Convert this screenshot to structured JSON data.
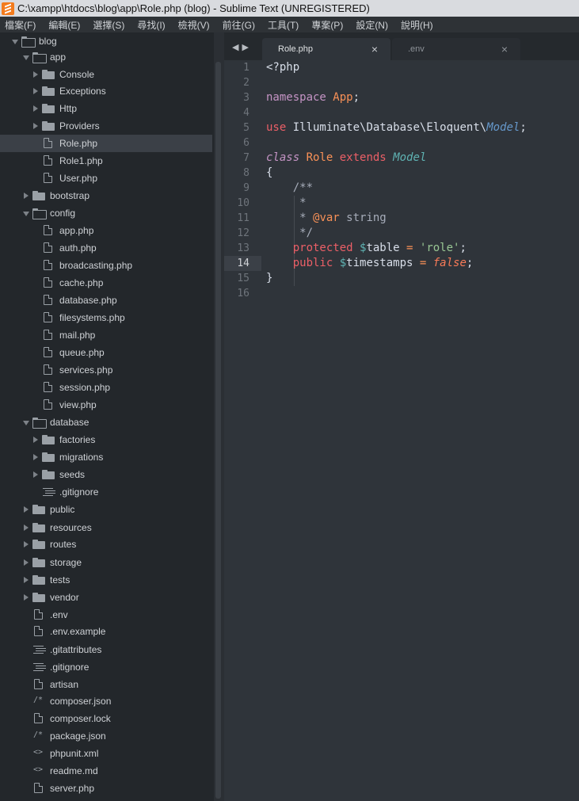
{
  "window": {
    "title": "C:\\xampp\\htdocs\\blog\\app\\Role.php (blog) - Sublime Text (UNREGISTERED)"
  },
  "menu": [
    "檔案(F)",
    "編輯(E)",
    "選擇(S)",
    "尋找(I)",
    "檢視(V)",
    "前往(G)",
    "工具(T)",
    "專案(P)",
    "設定(N)",
    "說明(H)"
  ],
  "sidebar": {
    "items": [
      {
        "label": "blog",
        "type": "folder",
        "open": true,
        "depth": 0
      },
      {
        "label": "app",
        "type": "folder",
        "open": true,
        "depth": 1
      },
      {
        "label": "Console",
        "type": "folder",
        "open": false,
        "depth": 2
      },
      {
        "label": "Exceptions",
        "type": "folder",
        "open": false,
        "depth": 2
      },
      {
        "label": "Http",
        "type": "folder",
        "open": false,
        "depth": 2
      },
      {
        "label": "Providers",
        "type": "folder",
        "open": false,
        "depth": 2
      },
      {
        "label": "Role.php",
        "type": "file",
        "depth": 2,
        "selected": true
      },
      {
        "label": "Role1.php",
        "type": "file",
        "depth": 2
      },
      {
        "label": "User.php",
        "type": "file",
        "depth": 2
      },
      {
        "label": "bootstrap",
        "type": "folder",
        "open": false,
        "depth": 1
      },
      {
        "label": "config",
        "type": "folder",
        "open": true,
        "depth": 1
      },
      {
        "label": "app.php",
        "type": "file",
        "depth": 2
      },
      {
        "label": "auth.php",
        "type": "file",
        "depth": 2
      },
      {
        "label": "broadcasting.php",
        "type": "file",
        "depth": 2
      },
      {
        "label": "cache.php",
        "type": "file",
        "depth": 2
      },
      {
        "label": "database.php",
        "type": "file",
        "depth": 2
      },
      {
        "label": "filesystems.php",
        "type": "file",
        "depth": 2
      },
      {
        "label": "mail.php",
        "type": "file",
        "depth": 2
      },
      {
        "label": "queue.php",
        "type": "file",
        "depth": 2
      },
      {
        "label": "services.php",
        "type": "file",
        "depth": 2
      },
      {
        "label": "session.php",
        "type": "file",
        "depth": 2
      },
      {
        "label": "view.php",
        "type": "file",
        "depth": 2
      },
      {
        "label": "database",
        "type": "folder",
        "open": true,
        "depth": 1
      },
      {
        "label": "factories",
        "type": "folder",
        "open": false,
        "depth": 2
      },
      {
        "label": "migrations",
        "type": "folder",
        "open": false,
        "depth": 2
      },
      {
        "label": "seeds",
        "type": "folder",
        "open": false,
        "depth": 2
      },
      {
        "label": ".gitignore",
        "type": "text",
        "depth": 2
      },
      {
        "label": "public",
        "type": "folder",
        "open": false,
        "depth": 1
      },
      {
        "label": "resources",
        "type": "folder",
        "open": false,
        "depth": 1
      },
      {
        "label": "routes",
        "type": "folder",
        "open": false,
        "depth": 1
      },
      {
        "label": "storage",
        "type": "folder",
        "open": false,
        "depth": 1
      },
      {
        "label": "tests",
        "type": "folder",
        "open": false,
        "depth": 1
      },
      {
        "label": "vendor",
        "type": "folder",
        "open": false,
        "depth": 1
      },
      {
        "label": ".env",
        "type": "file",
        "depth": 1
      },
      {
        "label": ".env.example",
        "type": "file",
        "depth": 1
      },
      {
        "label": ".gitattributes",
        "type": "text",
        "depth": 1
      },
      {
        "label": ".gitignore",
        "type": "text",
        "depth": 1
      },
      {
        "label": "artisan",
        "type": "file",
        "depth": 1
      },
      {
        "label": "composer.json",
        "type": "json",
        "depth": 1
      },
      {
        "label": "composer.lock",
        "type": "file",
        "depth": 1
      },
      {
        "label": "package.json",
        "type": "json",
        "depth": 1
      },
      {
        "label": "phpunit.xml",
        "type": "xml",
        "depth": 1
      },
      {
        "label": "readme.md",
        "type": "xml",
        "depth": 1
      },
      {
        "label": "server.php",
        "type": "file",
        "depth": 1
      }
    ]
  },
  "tabs": [
    {
      "label": "Role.php",
      "active": true
    },
    {
      "label": ".env",
      "active": false
    }
  ],
  "editor": {
    "current_line": 14,
    "lines": [
      [
        [
          "<?php",
          "punct"
        ]
      ],
      [],
      [
        [
          "namespace ",
          "kw"
        ],
        [
          "App",
          "cls"
        ],
        [
          ";",
          "punct"
        ]
      ],
      [],
      [
        [
          "use ",
          "kw-red"
        ],
        [
          "Illuminate",
          "punct"
        ],
        [
          "\\",
          "ns-sep"
        ],
        [
          "Database",
          "punct"
        ],
        [
          "\\",
          "ns-sep"
        ],
        [
          "Eloquent",
          "punct"
        ],
        [
          "\\",
          "ns-sep"
        ],
        [
          "Model",
          "type-it"
        ],
        [
          ";",
          "punct"
        ]
      ],
      [],
      [
        [
          "class ",
          "kw-it"
        ],
        [
          "Role ",
          "cls"
        ],
        [
          "extends ",
          "kw-red"
        ],
        [
          "Model",
          "type-ext"
        ]
      ],
      [
        [
          "{",
          "punct"
        ]
      ],
      [
        [
          "    /**",
          "cm"
        ]
      ],
      [
        [
          "     *",
          "cm"
        ]
      ],
      [
        [
          "     * ",
          "cm"
        ],
        [
          "@var",
          "anno"
        ],
        [
          " string",
          "cm"
        ]
      ],
      [
        [
          "     */",
          "cm"
        ]
      ],
      [
        [
          "    protected ",
          "kw-red"
        ],
        [
          "$",
          "var-dollar"
        ],
        [
          "table ",
          "punct"
        ],
        [
          "= ",
          "op"
        ],
        [
          "'role'",
          "str"
        ],
        [
          ";",
          "punct"
        ]
      ],
      [
        [
          "    public ",
          "kw-red"
        ],
        [
          "$",
          "var-dollar"
        ],
        [
          "timestamps ",
          "punct"
        ],
        [
          "= ",
          "op"
        ],
        [
          "false",
          "bool"
        ],
        [
          ";",
          "punct"
        ]
      ],
      [
        [
          "}",
          "punct"
        ]
      ],
      []
    ]
  }
}
